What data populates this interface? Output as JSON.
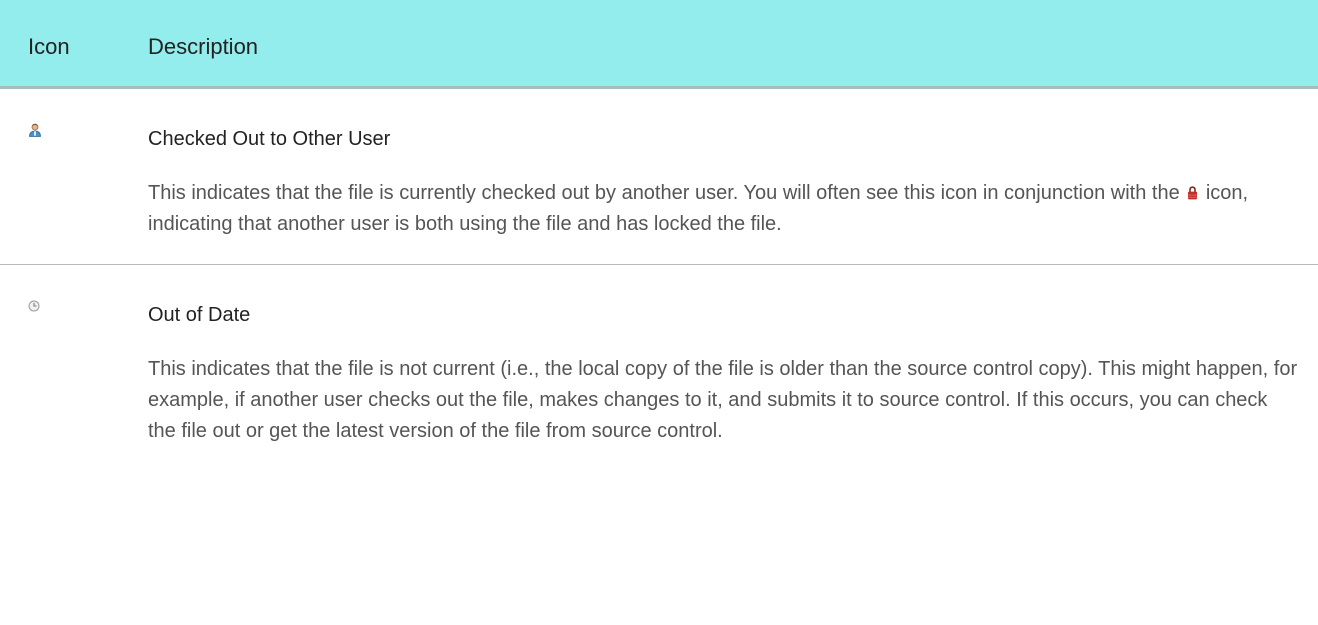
{
  "table": {
    "headers": {
      "icon": "Icon",
      "description": "Description"
    },
    "rows": [
      {
        "icon": "checked-out-other-user-icon",
        "title": "Checked Out to Other User",
        "body_before_icon": "This indicates that the file is currently checked out by another user. You will often see this icon in conjunction with the",
        "inline_icon": "lock-icon",
        "body_after_icon": "icon, indicating that another user is both using the file and has locked the file."
      },
      {
        "icon": "out-of-date-clock-icon",
        "title": "Out of Date",
        "body": "This indicates that the file is not current (i.e., the local copy of the file is older than the source control copy). This might happen, for example, if another user checks out the file, makes changes to it, and submits it to source control. If this occurs, you can check the file out or get the latest version of the file from source control."
      }
    ]
  },
  "colors": {
    "header_background": "#93eded",
    "header_border": "#a8bcbc",
    "row_divider": "#b9b9b9",
    "lock_red": "#c0302a"
  }
}
